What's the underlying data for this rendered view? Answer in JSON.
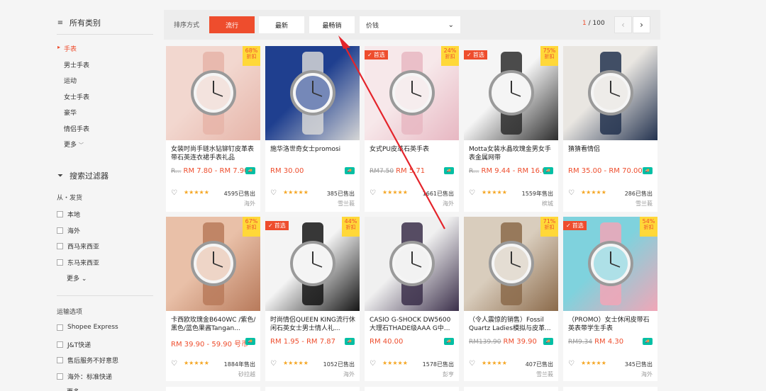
{
  "sidebar": {
    "categories_title": "所有类别",
    "categories": [
      "手表",
      "男士手表",
      "运动",
      "女士手表",
      "豪华",
      "情侣手表"
    ],
    "categories_more": "更多",
    "filter_title": "搜索过滤器",
    "ship_from_label": "从・发货",
    "ship_from": [
      "本地",
      "海外",
      "西马来西亚",
      "东马来西亚"
    ],
    "ship_from_more": "更多",
    "shipping_title": "运输选项",
    "shipping": [
      "Shopee Express",
      "J&T快递",
      "售后服务不好意思",
      "海外：标准快递"
    ],
    "shipping_more": "更多"
  },
  "sortbar": {
    "label": "排序方式",
    "popular": "流行",
    "latest": "最新",
    "top_sales": "最畅销",
    "price": "价钱",
    "page_current": "1",
    "page_total": "/ 100"
  },
  "products": [
    {
      "title": "女装时尚手链水钻铆钉皮革表带石英连衣裙手表礼品",
      "price_old": "R...",
      "price": "RM 7.80 - RM 7.90",
      "sold": "4595已售出",
      "loc": "海外",
      "pct": "68%",
      "pref": false,
      "free": true,
      "color1": "#f2d7cf",
      "color2": "#e6b4a8"
    },
    {
      "title": "施华洛世奇女士promosi",
      "price_old": "",
      "price": "RM 30.00",
      "sold": "385已售出",
      "loc": "雪兰莪",
      "pct": "",
      "pref": false,
      "free": true,
      "color1": "#1f3f8f",
      "color2": "#d6d6d6"
    },
    {
      "title": "女式PU皮革石英手表",
      "price_old": "RM7.50",
      "price": "RM 5.71",
      "sold": "1661已售出",
      "loc": "海外",
      "pct": "24%",
      "pref": true,
      "free": true,
      "color1": "#f7e8ea",
      "color2": "#e7b7c2"
    },
    {
      "title": "Motta女装水晶玫瑰金男女手表金属网带",
      "price_old": "R...",
      "price": "RM 9.44 - RM 16.00",
      "sold": "1559年售出",
      "loc": "槟城",
      "pct": "75%",
      "pref": true,
      "free": true,
      "color1": "#f5f5f5",
      "color2": "#2d2d2d"
    },
    {
      "title": "猜猜看情侣",
      "price_old": "",
      "price": "RM 35.00 - RM 70.00",
      "sold": "286已售出",
      "loc": "雪兰莪",
      "pct": "",
      "pref": false,
      "free": true,
      "color1": "#e9e6e1",
      "color2": "#23324f"
    },
    {
      "title": "卡西欧玫瑰金B640WC /紫色/黑色/蓝色果酱Tangan...",
      "price_old": "",
      "price": "RM 39.90 - 59.90 号币",
      "sold": "1884年售出",
      "loc": "砂拉越",
      "pct": "67%",
      "pref": false,
      "free": true,
      "color1": "#e9c0a8",
      "color2": "#b87a5b"
    },
    {
      "title": "时尚情侣QUEEN KING流行休闲石英女士男士情人礼...",
      "price_old": "",
      "price": "RM 1.95 - RM 7.87",
      "sold": "1052已售出",
      "loc": "海外",
      "pct": "44%",
      "pref": true,
      "free": true,
      "color1": "#f4f4f4",
      "color2": "#151515"
    },
    {
      "title": "CASIO G-SHOCK DW5600大理石THADE级AAA G中...",
      "price_old": "",
      "price": "RM 40.00",
      "sold": "1578已售出",
      "loc": "彭亨",
      "pct": "",
      "pref": false,
      "free": true,
      "color1": "#f0f0f0",
      "color2": "#3b2f4a"
    },
    {
      "title": "（令人震惊的销售）Fossil Quartz Ladies模拟与皮革...",
      "price_old": "RM139.90",
      "price": "RM 39.90",
      "sold": "407已售出",
      "loc": "雪兰莪",
      "pct": "71%",
      "pref": false,
      "free": true,
      "color1": "#d9cdbd",
      "color2": "#8b6a4a"
    },
    {
      "title": "（PROMO）女士休闲皮带石英表带学生手表",
      "price_old": "RM9.34",
      "price": "RM 4.30",
      "sold": "345已售出",
      "loc": "海外",
      "pct": "54%",
      "pref": true,
      "free": true,
      "color1": "#7fd2dd",
      "color2": "#f1a6b7"
    }
  ],
  "badges": {
    "preferred": "首选",
    "off": "折扣"
  },
  "colors": {
    "accent": "#ee4d2d",
    "star": "#f5a623",
    "free_ship": "#00bfa5"
  }
}
